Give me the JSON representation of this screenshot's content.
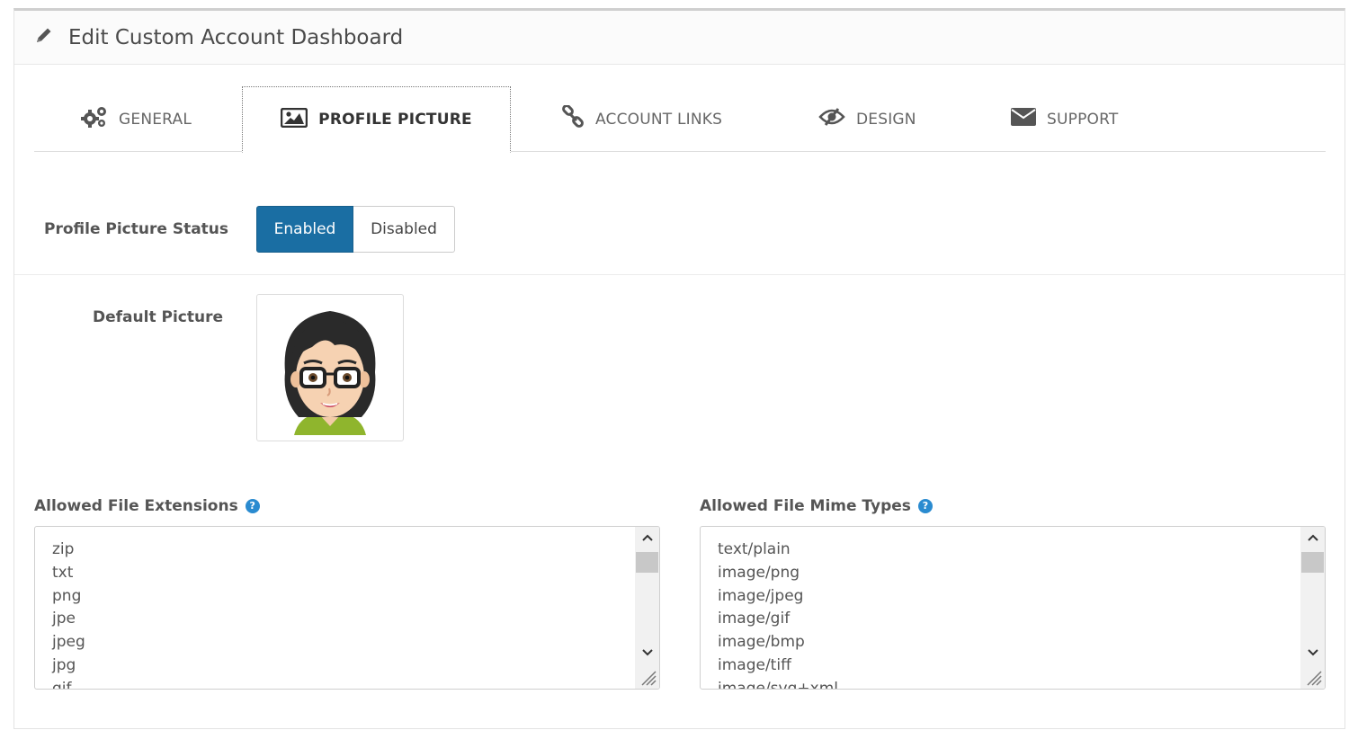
{
  "header": {
    "title": "Edit Custom Account Dashboard",
    "icon": "pencil-icon"
  },
  "tabs": [
    {
      "label": "GENERAL",
      "icon": "gears-icon",
      "active": false
    },
    {
      "label": "PROFILE PICTURE",
      "icon": "picture-icon",
      "active": true
    },
    {
      "label": "ACCOUNT LINKS",
      "icon": "link-icon",
      "active": false
    },
    {
      "label": "DESIGN",
      "icon": "eye-slash-icon",
      "active": false
    },
    {
      "label": "SUPPORT",
      "icon": "envelope-icon",
      "active": false
    }
  ],
  "status": {
    "label": "Profile Picture Status",
    "enabled_label": "Enabled",
    "disabled_label": "Disabled",
    "selected": "Enabled"
  },
  "default_picture": {
    "label": "Default Picture"
  },
  "extensions": {
    "label": "Allowed File Extensions",
    "values": [
      "zip",
      "txt",
      "png",
      "jpe",
      "jpeg",
      "jpg",
      "gif"
    ]
  },
  "mime_types": {
    "label": "Allowed File Mime Types",
    "values": [
      "text/plain",
      "image/png",
      "image/jpeg",
      "image/gif",
      "image/bmp",
      "image/tiff",
      "image/svg+xml"
    ]
  },
  "colors": {
    "accent": "#1a6ea3",
    "help": "#2a8bd0"
  }
}
